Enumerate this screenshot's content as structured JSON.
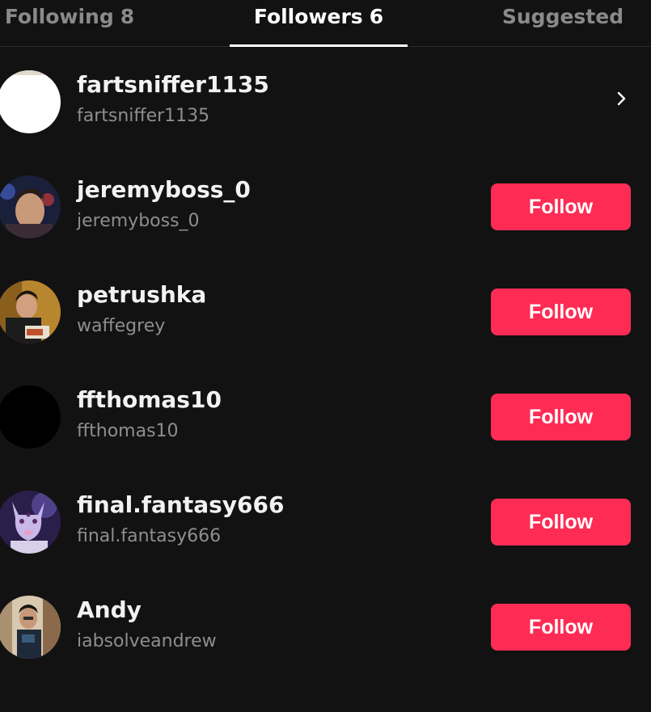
{
  "tabs": {
    "following": {
      "label": "Following",
      "count": "8"
    },
    "followers": {
      "label": "Followers",
      "count": "6"
    },
    "suggested": {
      "label": "Suggested"
    }
  },
  "users": [
    {
      "display_name": "fartsniffer1135",
      "username": "fartsniffer1135",
      "action": "chevron"
    },
    {
      "display_name": "jeremyboss_0",
      "username": "jeremyboss_0",
      "action": "Follow"
    },
    {
      "display_name": "petrushka",
      "username": "waffegrey",
      "action": "Follow"
    },
    {
      "display_name": "ffthomas10",
      "username": "ffthomas10",
      "action": "Follow"
    },
    {
      "display_name": "final.fantasy666",
      "username": "final.fantasy666",
      "action": "Follow"
    },
    {
      "display_name": "Andy",
      "username": "iabsolveandrew",
      "action": "Follow"
    }
  ],
  "colors": {
    "background": "#121212",
    "follow_button": "#fe2c55",
    "inactive_tab": "#8a8a8a",
    "secondary_text": "#8e8e8e"
  },
  "icons": {
    "row_chevron": "chevron-right-icon"
  }
}
